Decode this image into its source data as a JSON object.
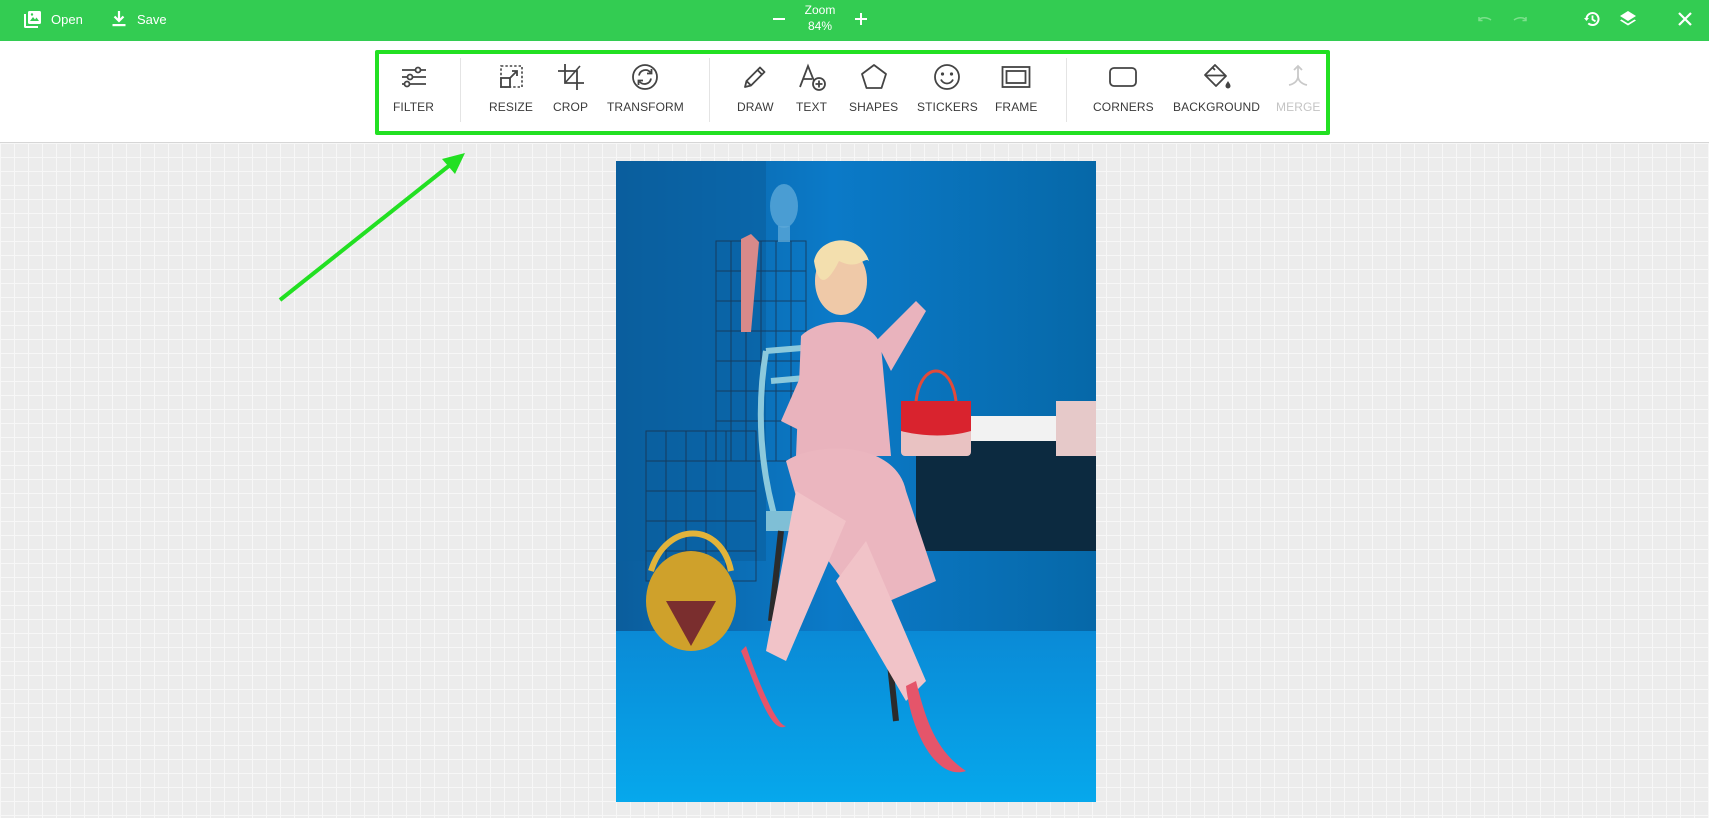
{
  "topbar": {
    "open_label": "Open",
    "save_label": "Save",
    "zoom_label": "Zoom",
    "zoom_value": "84%",
    "bg_color": "#33cc52"
  },
  "toolbar": {
    "tools": [
      {
        "label": "FILTER",
        "icon": "sliders-icon"
      },
      {
        "label": "RESIZE",
        "icon": "resize-icon"
      },
      {
        "label": "CROP",
        "icon": "crop-icon"
      },
      {
        "label": "TRANSFORM",
        "icon": "rotate-icon"
      },
      {
        "label": "DRAW",
        "icon": "pencil-icon"
      },
      {
        "label": "TEXT",
        "icon": "text-add-icon"
      },
      {
        "label": "SHAPES",
        "icon": "pentagon-icon"
      },
      {
        "label": "STICKERS",
        "icon": "smiley-icon"
      },
      {
        "label": "FRAME",
        "icon": "frame-icon"
      },
      {
        "label": "CORNERS",
        "icon": "rounded-rect-icon"
      },
      {
        "label": "BACKGROUND",
        "icon": "paint-bucket-icon"
      },
      {
        "label": "MERGE",
        "icon": "merge-icon",
        "disabled": true
      }
    ],
    "highlight_color": "#22e022"
  },
  "canvas": {
    "image_subject": "woman in pink outfit seated on chair against blue background"
  }
}
